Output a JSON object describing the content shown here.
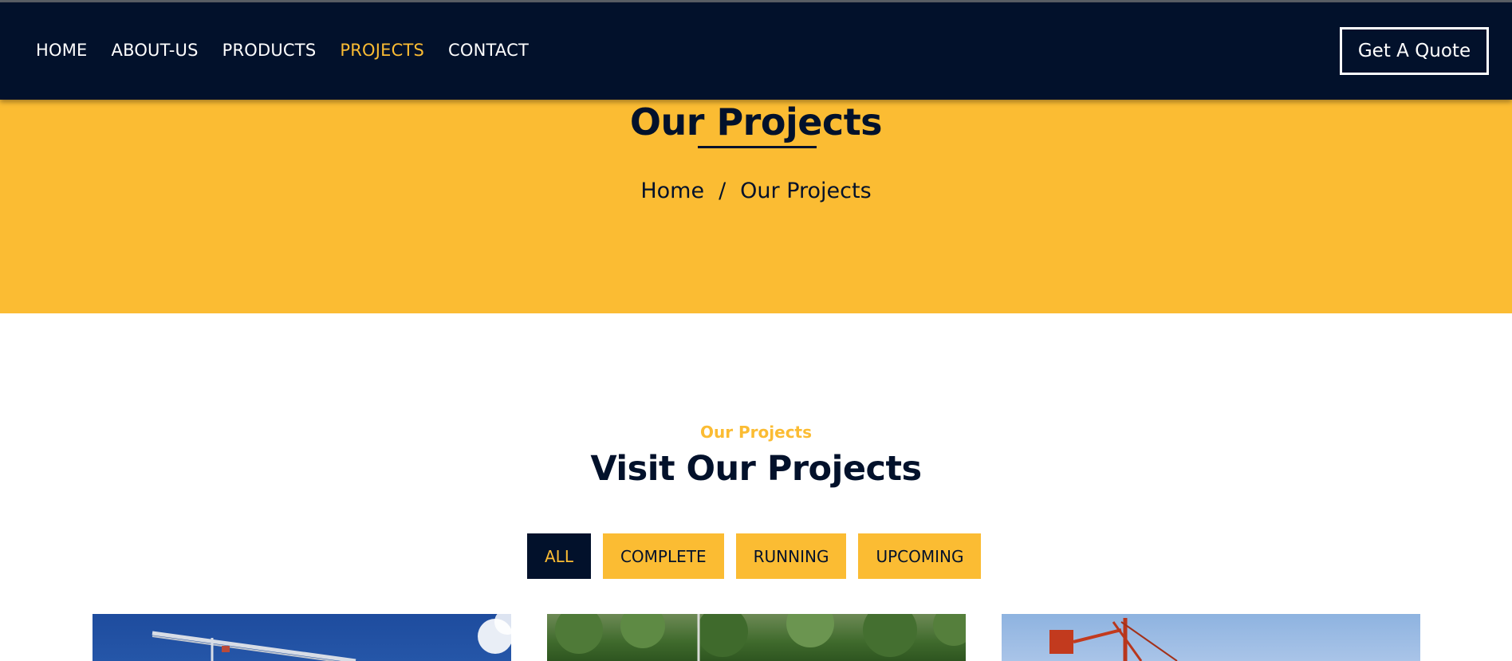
{
  "nav": {
    "items": [
      {
        "label": "HOME",
        "active": false
      },
      {
        "label": "ABOUT-US",
        "active": false
      },
      {
        "label": "PRODUCTS",
        "active": false
      },
      {
        "label": "PROJECTS",
        "active": true
      },
      {
        "label": "CONTACT",
        "active": false
      }
    ],
    "cta_label": "Get A Quote"
  },
  "hero": {
    "title": "Our Projects",
    "breadcrumb": {
      "home": "Home",
      "separator": "/",
      "current": "Our Projects"
    }
  },
  "section": {
    "subtitle": "Our Projects",
    "title": "Visit Our Projects"
  },
  "filters": [
    {
      "label": "ALL",
      "active": true
    },
    {
      "label": "COMPLETE",
      "active": false
    },
    {
      "label": "RUNNING",
      "active": false
    },
    {
      "label": "UPCOMING",
      "active": false
    }
  ],
  "projects": [
    {
      "icon": "crane-photo"
    },
    {
      "icon": "forest-photo"
    },
    {
      "icon": "red-crane-photo"
    }
  ],
  "colors": {
    "navy": "#02112b",
    "accent_yellow": "#fbbc33",
    "white": "#ffffff"
  }
}
